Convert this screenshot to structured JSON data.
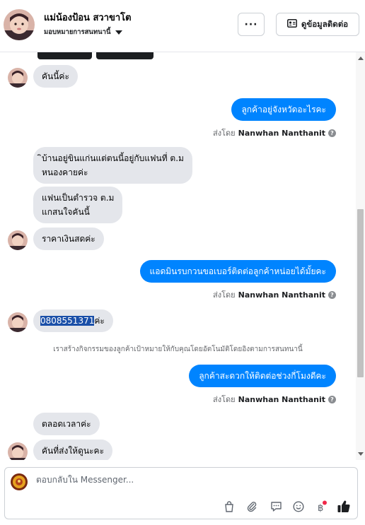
{
  "header": {
    "contact_name": "แม่น้องป้อน สวาขาโต",
    "assign_label": "มอบหมายการสนทนานี้",
    "more_label": "···",
    "contact_info_label": "ดูข้อมูลติดต่อ"
  },
  "thread": {
    "messages": [
      {
        "from": "customer",
        "text": "คันนี้ค่ะ"
      },
      {
        "from": "page",
        "text": "ลูกค้าอยู่จังหวัดอะไรคะ"
      },
      {
        "from": "customer",
        "text_line1": "ิบ้านอยู่ขินแก่นแต่ตนนี้อยู่กับแฟนที่ ต.ม",
        "text_line2": "หนองคายค่ะ"
      },
      {
        "from": "customer",
        "text_line1": "แฟนเป็นตำรวจ ต.ม",
        "text_line2": "แกสนใจคันนี้"
      },
      {
        "from": "customer",
        "text": "ราคาเงินสดค่ะ"
      },
      {
        "from": "page",
        "text": "แอดมินรบกวนขอเบอร์ติดต่อลูกค้าหน่อยได้มั้ยคะ"
      },
      {
        "from": "customer",
        "phone": "0808551371",
        "suffix": "ค่ะ"
      },
      {
        "from": "page",
        "text": "ลูกค้าสะดวกให้ติดต่อช่วงกี่โมงดีคะ"
      },
      {
        "from": "customer",
        "text": "ตลอดเวลาค่ะ"
      },
      {
        "from": "customer",
        "text": "คันที่ส่งให้ดูนะคะ"
      }
    ],
    "sent_by_prefix": "ส่งโดย",
    "sent_by_name": "Nanwhan Nanthanit",
    "system_note": "เราสร้างกิจกรรมของลูกค้าเป้าหมายให้กับคุณโดยอัตโนมัติโดยอิงตามการสนทนานี้"
  },
  "composer": {
    "placeholder": "ตอบกลับใน Messenger..."
  },
  "colors": {
    "outgoing_bubble": "#0084ff",
    "incoming_bubble": "#e4e6eb",
    "like_icon": "#1c1e21",
    "notification_dot": "#f02849"
  },
  "icons": [
    "more-icon",
    "contact-card-icon",
    "caret-down-icon",
    "info-icon",
    "shopping-bag-icon",
    "attach-icon",
    "saved-reply-icon",
    "emoji-icon",
    "baht-payment-icon",
    "like-icon"
  ]
}
